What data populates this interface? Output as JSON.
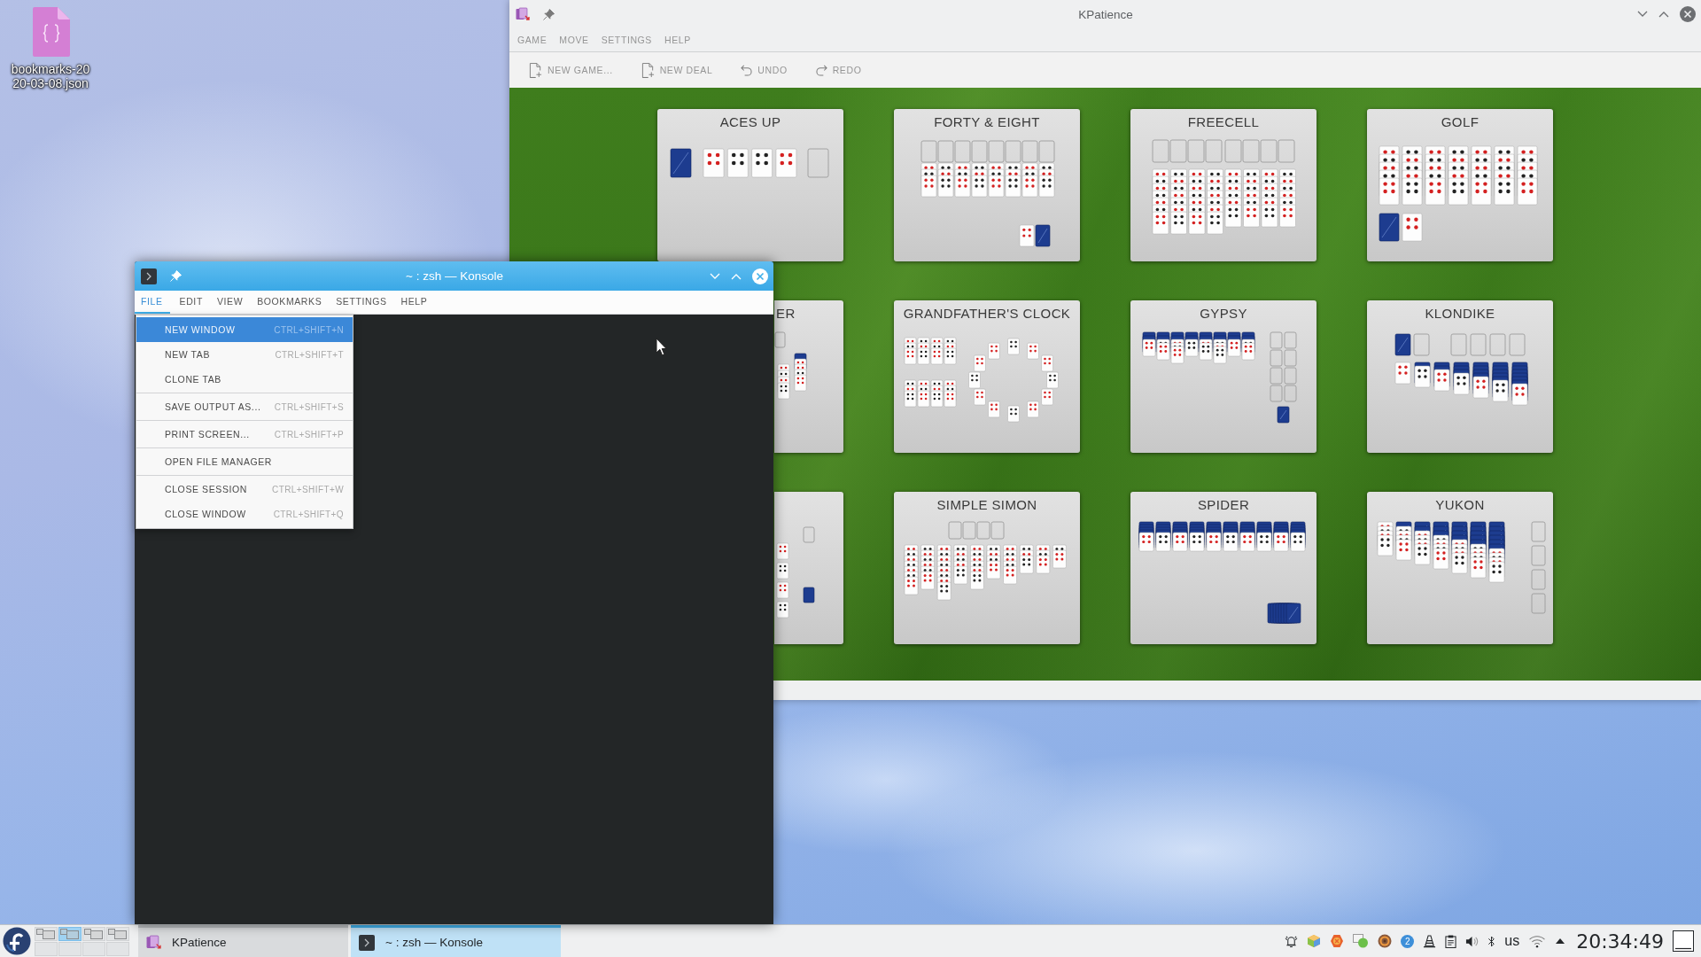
{
  "desktop": {
    "icons": [
      {
        "label": "bookmarks-2020-03-08.json"
      }
    ]
  },
  "kpatience": {
    "title": "KPatience",
    "menu": [
      "GAME",
      "MOVE",
      "SETTINGS",
      "HELP"
    ],
    "toolbar": [
      "NEW GAME...",
      "NEW DEAL",
      "UNDO",
      "REDO"
    ],
    "games": [
      {
        "kind": "tile",
        "title": "ACES UP"
      },
      {
        "kind": "tile",
        "title": "FORTY & EIGHT"
      },
      {
        "kind": "tile",
        "title": "FREECELL"
      },
      {
        "kind": "tile",
        "title": "GOLF"
      },
      {
        "kind": "covered",
        "title": "ER"
      },
      {
        "kind": "tile",
        "title": "GRANDFATHER'S CLOCK"
      },
      {
        "kind": "tile",
        "title": "GYPSY"
      },
      {
        "kind": "tile",
        "title": "KLONDIKE"
      },
      {
        "kind": "covered"
      },
      {
        "kind": "tile",
        "title": "SIMPLE SIMON"
      },
      {
        "kind": "tile",
        "title": "SPIDER"
      },
      {
        "kind": "tile",
        "title": "YUKON"
      }
    ]
  },
  "konsole": {
    "title": "~ : zsh — Konsole",
    "menu": [
      {
        "label": "FILE",
        "selected": true
      },
      {
        "label": "EDIT",
        "selected": false
      },
      {
        "label": "VIEW",
        "selected": false
      },
      {
        "label": "BOOKMARKS",
        "selected": false
      },
      {
        "label": "SETTINGS",
        "selected": false
      },
      {
        "label": "HELP",
        "selected": false
      }
    ],
    "file_menu": {
      "groups": [
        {
          "items": [
            {
              "label": "NEW WINDOW",
              "shortcut": "CTRL+SHIFT+N",
              "selected": true
            },
            {
              "label": "NEW TAB",
              "shortcut": "CTRL+SHIFT+T",
              "selected": false
            },
            {
              "label": "CLONE TAB",
              "selected": false
            }
          ]
        },
        {
          "items": [
            {
              "label": "SAVE OUTPUT AS...",
              "shortcut": "CTRL+SHIFT+S",
              "selected": false
            }
          ]
        },
        {
          "items": [
            {
              "label": "PRINT SCREEN...",
              "shortcut": "CTRL+SHIFT+P",
              "selected": false
            }
          ]
        },
        {
          "items": [
            {
              "label": "OPEN FILE MANAGER",
              "selected": false
            }
          ]
        },
        {
          "items": [
            {
              "label": "CLOSE SESSION",
              "shortcut": "CTRL+SHIFT+W",
              "selected": false
            },
            {
              "label": "CLOSE WINDOW",
              "shortcut": "CTRL+SHIFT+Q",
              "selected": false
            }
          ]
        }
      ]
    }
  },
  "taskbar": {
    "pager": [
      {
        "selected": false
      },
      {
        "selected": true
      },
      {
        "selected": false
      },
      {
        "selected": false
      },
      {
        "selected": false
      },
      {
        "selected": false
      },
      {
        "selected": false
      },
      {
        "selected": false
      }
    ],
    "tasks": [
      {
        "label": "KPatience",
        "selected": false
      },
      {
        "label": "~ : zsh — Konsole",
        "selected": true
      }
    ],
    "tray": {
      "notification_count": "2",
      "keyboard_layout": "us"
    },
    "clock": "20:34:49"
  }
}
